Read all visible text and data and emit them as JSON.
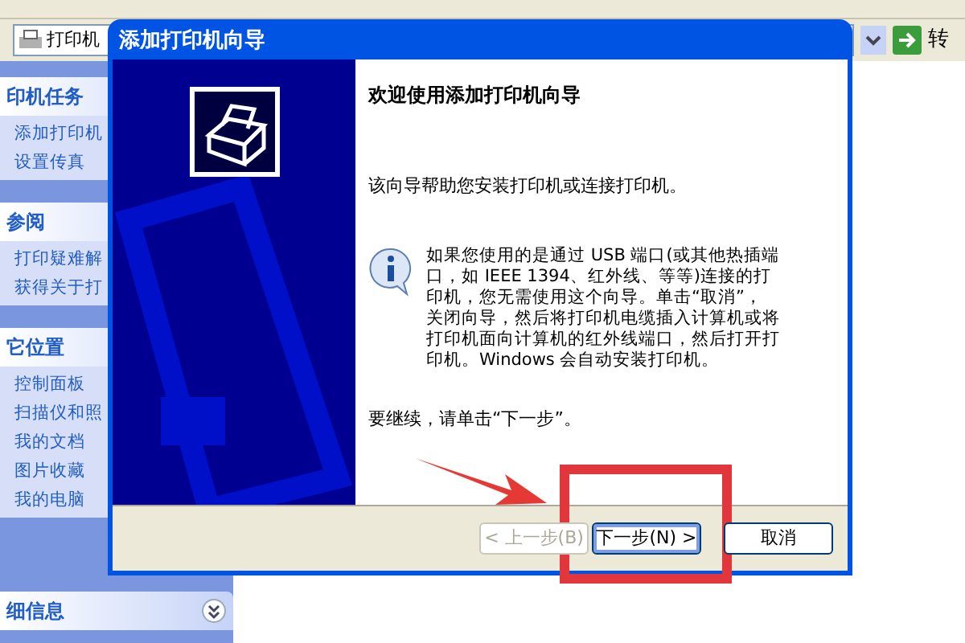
{
  "explorer": {
    "address": "打印机",
    "go_label": "转",
    "sidebar": [
      {
        "title": "印机任务",
        "items": [
          "添加打印机",
          "设置传真"
        ]
      },
      {
        "title": "参阅",
        "items": [
          "打印疑难解",
          "获得关于打"
        ]
      },
      {
        "title": "它位置",
        "items": [
          "控制面板",
          "扫描仪和照",
          "我的文档",
          "图片收藏",
          "我的电脑"
        ]
      },
      {
        "title": "细信息"
      }
    ]
  },
  "dialog": {
    "title": "添加打印机向导",
    "heading": "欢迎使用添加打印机向导",
    "intro": "该向导帮助您安装打印机或连接打印机。",
    "info_lines": [
      "如果您使用的是通过 USB 端口(或其他热插端",
      "口，如 IEEE 1394、红外线、等等)连接的打",
      "印机，您无需使用这个向导。单击“取消”，",
      "关闭向导，然后将打印机电缆插入计算机或将",
      "打印机面向计算机的红外线端口，然后打开打",
      "印机。Windows 会自动安装打印机。"
    ],
    "continue": "要继续，请单击“下一步”。",
    "buttons": [
      {
        "label": "< 上一步(B)",
        "disabled": true,
        "focused": false
      },
      {
        "label": "下一步(N) >",
        "disabled": false,
        "focused": true
      },
      {
        "label": "取消",
        "disabled": false,
        "focused": false
      }
    ]
  }
}
